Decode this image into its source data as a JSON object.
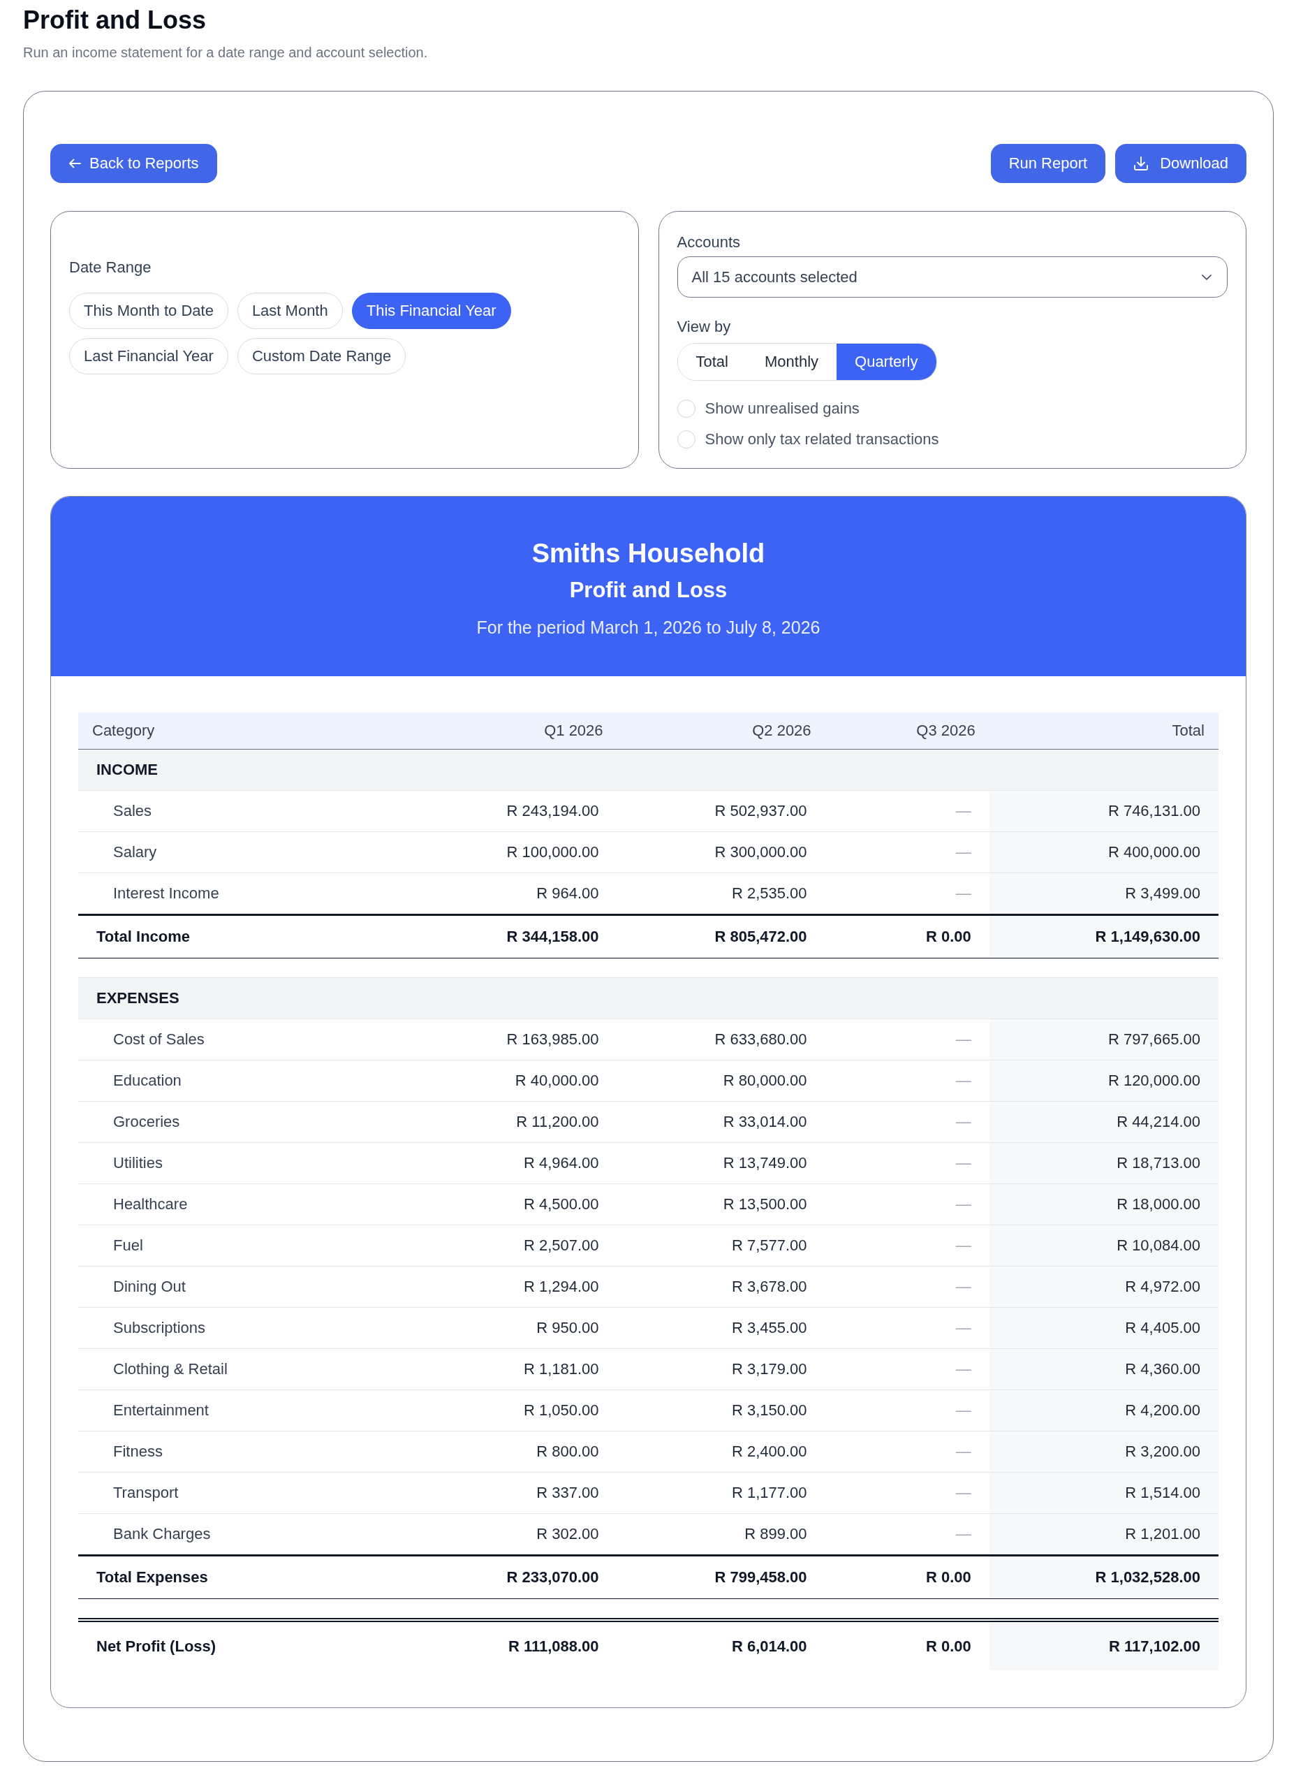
{
  "page": {
    "title": "Profit and Loss",
    "subtitle": "Run an income statement for a date range and account selection."
  },
  "toolbar": {
    "back_button": "Back to Reports",
    "actions": [
      {
        "label": "Run Report",
        "kind": "run"
      },
      {
        "label": "Download",
        "kind": "download"
      }
    ]
  },
  "date_range": {
    "label": "Date Range",
    "options": [
      {
        "label": "This Month to Date",
        "selected": false
      },
      {
        "label": "Last Month",
        "selected": false
      },
      {
        "label": "This Financial Year",
        "selected": true
      },
      {
        "label": "Last Financial Year",
        "selected": false
      },
      {
        "label": "Custom Date Range",
        "selected": false
      }
    ]
  },
  "accounts": {
    "label": "Accounts",
    "value": "All 15 accounts selected"
  },
  "view_by": {
    "label": "View by",
    "options": [
      {
        "label": "Total",
        "selected": false
      },
      {
        "label": "Monthly",
        "selected": false
      },
      {
        "label": "Quarterly",
        "selected": true
      }
    ]
  },
  "toggles": [
    {
      "label": "Show unrealised gains",
      "checked": false
    },
    {
      "label": "Show only tax related transactions",
      "checked": false
    }
  ],
  "report": {
    "entity": "Smiths Household",
    "title": "Profit and Loss",
    "period": "For the period March 1, 2026 to July 8, 2026",
    "columns": [
      "Category",
      "Q1 2026",
      "Q2 2026",
      "Q3 2026",
      "Total"
    ],
    "sections": [
      {
        "title": "INCOME",
        "rows": [
          {
            "category": "Sales",
            "values": [
              "R 243,194.00",
              "R 502,937.00",
              "—",
              "R 746,131.00"
            ],
            "muted": [
              false,
              false,
              true,
              false
            ]
          },
          {
            "category": "Salary",
            "values": [
              "R 100,000.00",
              "R 300,000.00",
              "—",
              "R 400,000.00"
            ],
            "muted": [
              false,
              false,
              true,
              false
            ]
          },
          {
            "category": "Interest Income",
            "values": [
              "R 964.00",
              "R 2,535.00",
              "—",
              "R 3,499.00"
            ],
            "muted": [
              false,
              false,
              true,
              false
            ]
          }
        ],
        "total": {
          "label": "Total Income",
          "values": [
            "R 344,158.00",
            "R 805,472.00",
            "R 0.00",
            "R 1,149,630.00"
          ]
        }
      },
      {
        "title": "EXPENSES",
        "rows": [
          {
            "category": "Cost of Sales",
            "values": [
              "R 163,985.00",
              "R 633,680.00",
              "—",
              "R 797,665.00"
            ],
            "muted": [
              false,
              false,
              true,
              false
            ]
          },
          {
            "category": "Education",
            "values": [
              "R 40,000.00",
              "R 80,000.00",
              "—",
              "R 120,000.00"
            ],
            "muted": [
              false,
              false,
              true,
              false
            ]
          },
          {
            "category": "Groceries",
            "values": [
              "R 11,200.00",
              "R 33,014.00",
              "—",
              "R 44,214.00"
            ],
            "muted": [
              false,
              false,
              true,
              false
            ]
          },
          {
            "category": "Utilities",
            "values": [
              "R 4,964.00",
              "R 13,749.00",
              "—",
              "R 18,713.00"
            ],
            "muted": [
              false,
              false,
              true,
              false
            ]
          },
          {
            "category": "Healthcare",
            "values": [
              "R 4,500.00",
              "R 13,500.00",
              "—",
              "R 18,000.00"
            ],
            "muted": [
              false,
              false,
              true,
              false
            ]
          },
          {
            "category": "Fuel",
            "values": [
              "R 2,507.00",
              "R 7,577.00",
              "—",
              "R 10,084.00"
            ],
            "muted": [
              false,
              false,
              true,
              false
            ]
          },
          {
            "category": "Dining Out",
            "values": [
              "R 1,294.00",
              "R 3,678.00",
              "—",
              "R 4,972.00"
            ],
            "muted": [
              false,
              false,
              true,
              false
            ]
          },
          {
            "category": "Subscriptions",
            "values": [
              "R 950.00",
              "R 3,455.00",
              "—",
              "R 4,405.00"
            ],
            "muted": [
              false,
              false,
              true,
              false
            ]
          },
          {
            "category": "Clothing & Retail",
            "values": [
              "R 1,181.00",
              "R 3,179.00",
              "—",
              "R 4,360.00"
            ],
            "muted": [
              false,
              false,
              true,
              false
            ]
          },
          {
            "category": "Entertainment",
            "values": [
              "R 1,050.00",
              "R 3,150.00",
              "—",
              "R 4,200.00"
            ],
            "muted": [
              false,
              false,
              true,
              false
            ]
          },
          {
            "category": "Fitness",
            "values": [
              "R 800.00",
              "R 2,400.00",
              "—",
              "R 3,200.00"
            ],
            "muted": [
              false,
              false,
              true,
              false
            ]
          },
          {
            "category": "Transport",
            "values": [
              "R 337.00",
              "R 1,177.00",
              "—",
              "R 1,514.00"
            ],
            "muted": [
              false,
              false,
              true,
              false
            ]
          },
          {
            "category": "Bank Charges",
            "values": [
              "R 302.00",
              "R 899.00",
              "—",
              "R 1,201.00"
            ],
            "muted": [
              false,
              false,
              true,
              false
            ]
          }
        ],
        "total": {
          "label": "Total Expenses",
          "values": [
            "R 233,070.00",
            "R 799,458.00",
            "R 0.00",
            "R 1,032,528.00"
          ]
        }
      }
    ],
    "net": {
      "label": "Net Profit (Loss)",
      "values": [
        "R 111,088.00",
        "R 6,014.00",
        "R 0.00",
        "R 117,102.00"
      ]
    }
  }
}
